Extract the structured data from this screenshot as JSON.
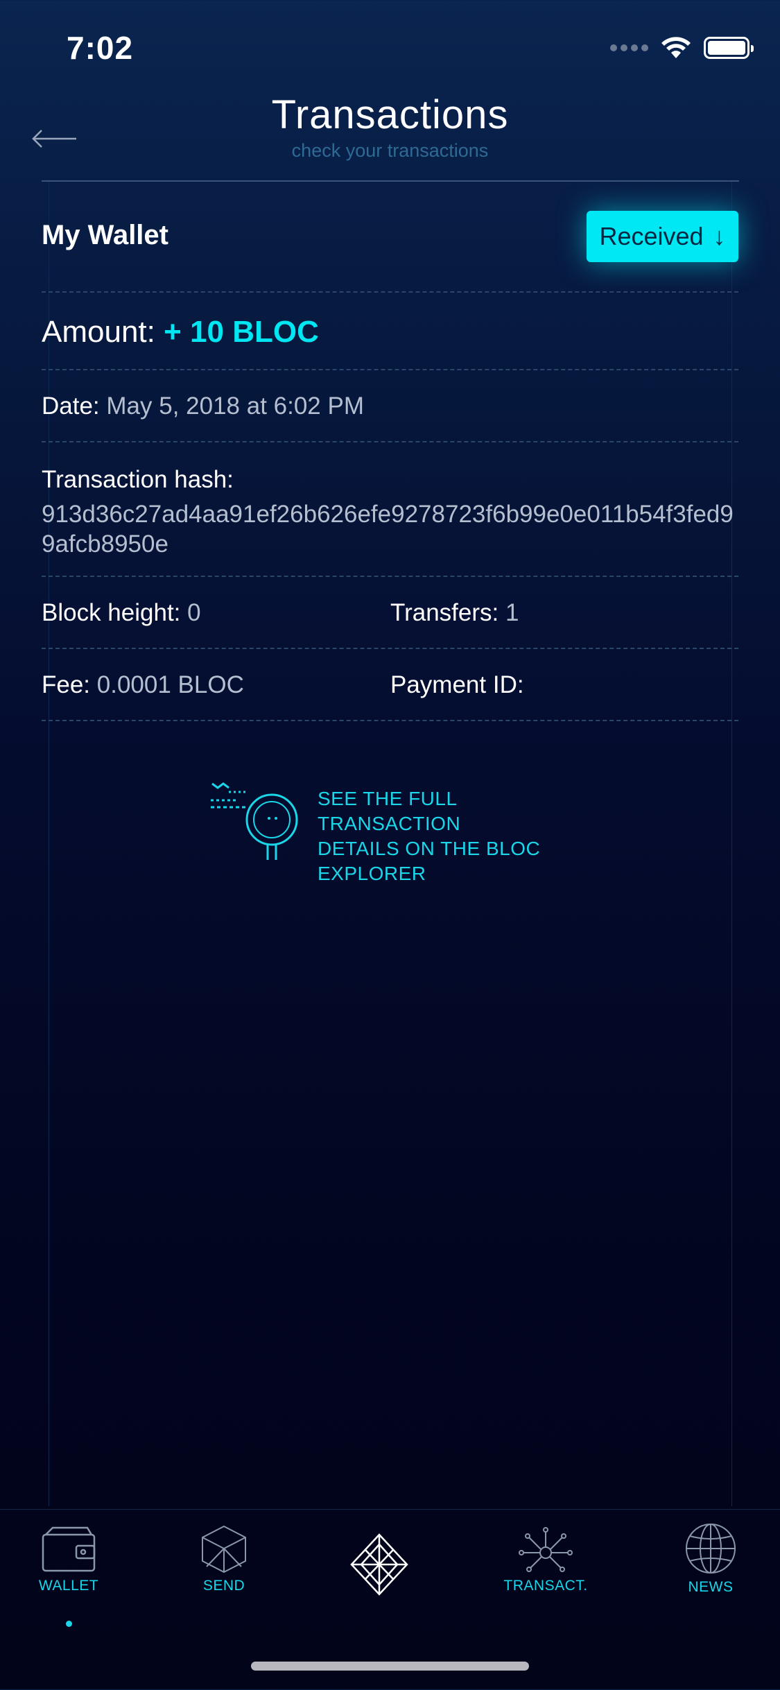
{
  "status_bar": {
    "time": "7:02"
  },
  "header": {
    "title": "Transactions",
    "subtitle": "check your transactions"
  },
  "wallet": {
    "name": "My Wallet",
    "status_label": "Received",
    "status_arrow": "↓"
  },
  "amount": {
    "label": "Amount:",
    "value": "+ 10 BLOC"
  },
  "date": {
    "label": "Date:",
    "value": "May 5, 2018 at 6:02 PM"
  },
  "hash": {
    "label": "Transaction hash:",
    "value": "913d36c27ad4aa91ef26b626efe9278723f6b99e0e011b54f3fed99afcb8950e"
  },
  "block_height": {
    "label": "Block height:",
    "value": "0"
  },
  "transfers": {
    "label": "Transfers:",
    "value": "1"
  },
  "fee": {
    "label": "Fee:",
    "value": "0.0001 BLOC"
  },
  "payment_id": {
    "label": "Payment ID:",
    "value": ""
  },
  "explorer": {
    "text_line1": "SEE THE FULL TRANSACTION",
    "text_line2": "DETAILS ON THE BLOC",
    "text_line3": "EXPLORER"
  },
  "tabs": [
    {
      "label": "WALLET",
      "icon": "wallet-icon",
      "active": true
    },
    {
      "label": "SEND",
      "icon": "send-cube-icon"
    },
    {
      "label": "",
      "icon": "bloc-logo-icon"
    },
    {
      "label": "TRANSACT.",
      "icon": "network-nodes-icon"
    },
    {
      "label": "NEWS",
      "icon": "globe-icon"
    }
  ],
  "colors": {
    "accent": "#00e8f4",
    "background_top": "#0a2550",
    "background_bottom": "#02041a"
  }
}
